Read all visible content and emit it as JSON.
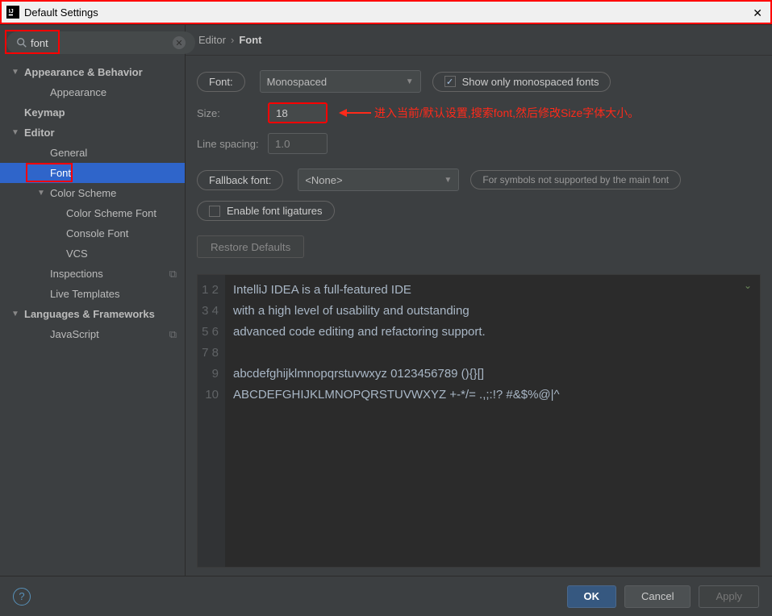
{
  "window": {
    "title": "Default Settings"
  },
  "search": {
    "value": "font"
  },
  "sidebar": {
    "items": [
      {
        "label": "Appearance & Behavior",
        "level": 1,
        "expandable": true,
        "bold": true
      },
      {
        "label": "Appearance",
        "level": 2
      },
      {
        "label": "Keymap",
        "level": 1,
        "bold": true,
        "noarrow": true
      },
      {
        "label": "Editor",
        "level": 1,
        "expandable": true,
        "bold": true
      },
      {
        "label": "General",
        "level": 2
      },
      {
        "label": "Font",
        "level": 2,
        "selected": true,
        "redbox": true
      },
      {
        "label": "Color Scheme",
        "level": 2,
        "expandable": true
      },
      {
        "label": "Color Scheme Font",
        "level": 3
      },
      {
        "label": "Console Font",
        "level": 3
      },
      {
        "label": "VCS",
        "level": 3
      },
      {
        "label": "Inspections",
        "level": 2,
        "trail": true
      },
      {
        "label": "Live Templates",
        "level": 2
      },
      {
        "label": "Languages & Frameworks",
        "level": 1,
        "expandable": true,
        "bold": true
      },
      {
        "label": "JavaScript",
        "level": 2,
        "trail": true
      }
    ]
  },
  "breadcrumb": {
    "root": "Editor",
    "leaf": "Font"
  },
  "form": {
    "font_label": "Font:",
    "font_value": "Monospaced",
    "show_mono_label": "Show only monospaced fonts",
    "show_mono_checked": true,
    "size_label": "Size:",
    "size_value": "18",
    "spacing_label": "Line spacing:",
    "spacing_value": "1.0",
    "fallback_label": "Fallback font:",
    "fallback_value": "<None>",
    "fallback_info": "For symbols not supported by the main font",
    "ligatures_label": "Enable font ligatures",
    "ligatures_checked": false,
    "restore_label": "Restore Defaults"
  },
  "annotation": {
    "text": "进入当前/默认设置,搜索font,然后修改Size字体大小。"
  },
  "preview": {
    "lines": [
      "IntelliJ IDEA is a full-featured IDE",
      "with a high level of usability and outstanding",
      "advanced code editing and refactoring support.",
      "",
      "abcdefghijklmnopqrstuvwxyz 0123456789 (){}[]",
      "ABCDEFGHIJKLMNOPQRSTUVWXYZ +-*/= .,;:!? #&$%@|^",
      "",
      "",
      "",
      ""
    ]
  },
  "footer": {
    "ok": "OK",
    "cancel": "Cancel",
    "apply": "Apply"
  }
}
